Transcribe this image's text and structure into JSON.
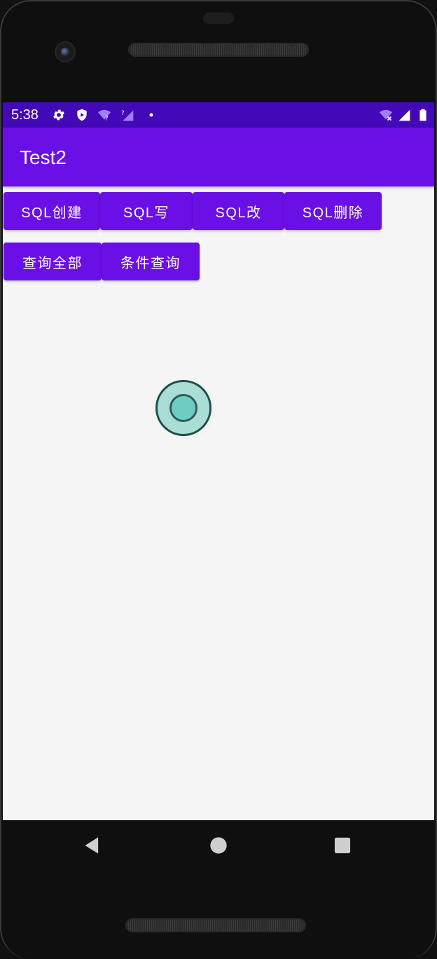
{
  "status_bar": {
    "time": "5:38",
    "icons": [
      "gear-icon",
      "shield-play-icon",
      "wifi-unknown-icon",
      "signal-unknown-icon",
      "notification-dot-icon",
      "wifi-no-internet-icon",
      "cell-signal-icon",
      "battery-icon"
    ],
    "background": "#4309b8"
  },
  "app_bar": {
    "title": "Test2",
    "background": "#6a0fe6"
  },
  "buttons": {
    "row1": [
      {
        "label": "SQL创建"
      },
      {
        "label": "SQL写"
      },
      {
        "label": "SQL改"
      },
      {
        "label": "SQL删除"
      }
    ],
    "row2": [
      {
        "label": "查询全部"
      },
      {
        "label": "条件查询"
      }
    ],
    "color": "#6a0fe6"
  },
  "touch_indicator": {
    "icon": "touch-point-icon"
  },
  "nav_bar": {
    "icons": [
      "back-icon",
      "home-icon",
      "recents-icon"
    ]
  }
}
